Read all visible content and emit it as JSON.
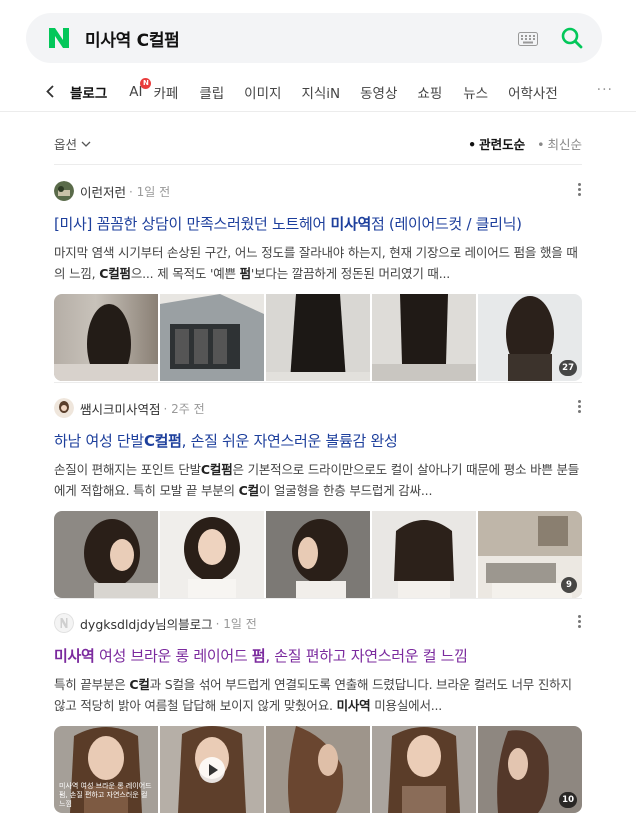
{
  "search": {
    "query": "미사역 C컬펌"
  },
  "tabs": {
    "items": [
      "블로그",
      "AI",
      "카페",
      "클립",
      "이미지",
      "지식iN",
      "동영상",
      "쇼핑",
      "뉴스",
      "어학사전"
    ],
    "ai_badge": "N",
    "more": "···"
  },
  "options": {
    "label": "옵션",
    "sort_relevance": "관련도순",
    "sort_latest": "최신순"
  },
  "results": [
    {
      "author": "이런저런",
      "date": "· 1일 전",
      "title_parts": [
        "[미사] 꼼꼼한 상담이 만족스러웠던 노트헤어 ",
        "미사역",
        "점 (레이어드컷 / 클리닉)"
      ],
      "desc_parts": [
        "마지막 염색 시기부터 손상된 구간, 어느 정도를 잘라내야 하는지, 현재 기장으로 레이어드 펌을 했을 때의 느낌, ",
        "C컬펌",
        "으... 제 목적도 '예쁜 ",
        "펌",
        "'보다는 깔끔하게 정돈된 머리였기 때..."
      ],
      "count": "27"
    },
    {
      "author": "쌤시크미사역점",
      "date": "· 2주 전",
      "title_parts": [
        "하남 여성 단발",
        "C컬펌",
        ", 손질 쉬운 자연스러운 볼륨감 완성"
      ],
      "desc_parts": [
        "손질이 편해지는 포인트 단발",
        "C컬펌",
        "은 기본적으로 드라이만으로도 컬이 살아나기 때문에 평소 바쁜 분들에게 적합해요. 특히 모발 끝 부분의 ",
        "C컬",
        "이 얼굴형을 한층 부드럽게 감싸..."
      ],
      "count": "9"
    },
    {
      "author": "dygksdldjdy님의블로그",
      "date": "· 1일 전",
      "title_parts": [
        "미사역",
        " 여성 브라운 롱 레이어드 ",
        "펌",
        ", 손질 편하고 자연스러운 컬 느낌"
      ],
      "desc_parts": [
        "특히 끝부분은 ",
        "C컬",
        "과 S컬을 섞어 부드럽게 연결되도록 연출해 드렸답니다. 브라운 컬러도 너무 진하지 않고 적당히 밝아 여름철 답답해 보이지 않게 맞췄어요. ",
        "미사역",
        " 미용실에서..."
      ],
      "caption": "미사역 여성 브라운 롱 레이어드 펌, 손질 편하고 자연스러운 컬 느낌",
      "count": "10"
    }
  ],
  "colors": {
    "brand": "#03c75a",
    "title_link": "#1d3f9c",
    "visited": "#7b2a9e"
  },
  "icons": [
    "naver-logo-icon",
    "keyboard-icon",
    "search-icon",
    "back-chevron-icon",
    "chevron-down-icon",
    "kebab-menu-icon",
    "play-icon"
  ]
}
